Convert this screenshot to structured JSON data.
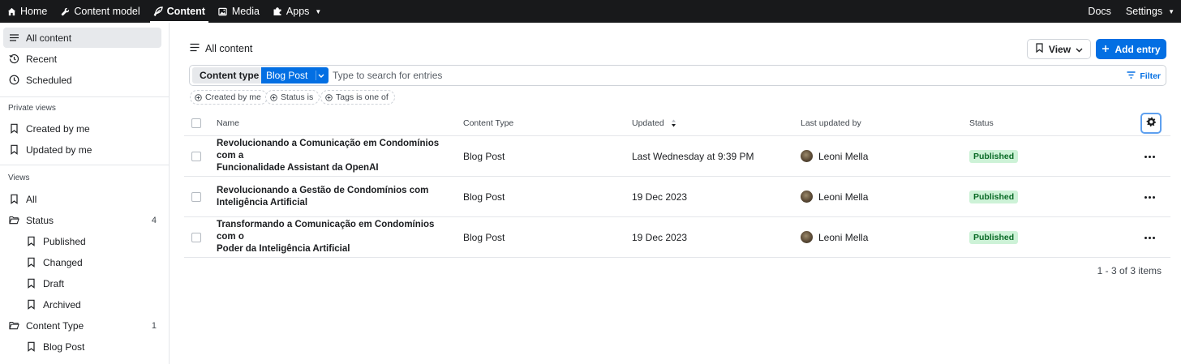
{
  "topnav": {
    "items": [
      {
        "label": "Home",
        "icon": "home-icon"
      },
      {
        "label": "Content model",
        "icon": "wrench-icon"
      },
      {
        "label": "Content",
        "icon": "feather-icon",
        "active": true
      },
      {
        "label": "Media",
        "icon": "image-icon"
      },
      {
        "label": "Apps",
        "icon": "puzzle-icon"
      }
    ],
    "docs": "Docs",
    "settings": "Settings"
  },
  "sidebar": {
    "top_items": [
      {
        "label": "All content",
        "icon": "list-icon",
        "active": true
      },
      {
        "label": "Recent",
        "icon": "history-icon"
      },
      {
        "label": "Scheduled",
        "icon": "clock-icon"
      }
    ],
    "private_heading": "Private views",
    "private_items": [
      {
        "label": "Created by me",
        "icon": "bookmark-icon"
      },
      {
        "label": "Updated by me",
        "icon": "bookmark-icon"
      }
    ],
    "views_heading": "Views",
    "views": {
      "all": "All",
      "status_folder": "Status",
      "status_count": "4",
      "status_items": [
        "Published",
        "Changed",
        "Draft",
        "Archived"
      ],
      "content_type_folder": "Content Type",
      "content_type_count": "1",
      "content_type_items": [
        "Blog Post"
      ]
    }
  },
  "main": {
    "title": "All content",
    "view_button": "View",
    "add_button": "Add entry",
    "search": {
      "content_type_label": "Content type",
      "content_type_value": "Blog Post",
      "placeholder": "Type to search for entries",
      "filter_label": "Filter"
    },
    "chips": [
      "Created by me",
      "Status is",
      "Tags is one of"
    ],
    "table": {
      "columns": [
        "Name",
        "Content Type",
        "Updated",
        "Last updated by",
        "Status"
      ],
      "rows": [
        {
          "name_line1": "Revolucionando a Comunicação em Condomínios com a",
          "name_line2": "Funcionalidade Assistant da OpenAI",
          "content_type": "Blog Post",
          "updated": "Last Wednesday at 9:39 PM",
          "author": "Leoni Mella",
          "status": "Published"
        },
        {
          "name_line1": "Revolucionando a Gestão de Condomínios com",
          "name_line2": "Inteligência Artificial",
          "content_type": "Blog Post",
          "updated": "19 Dec 2023",
          "author": "Leoni Mella",
          "status": "Published"
        },
        {
          "name_line1": "Transformando a Comunicação em Condomínios com o",
          "name_line2": "Poder da Inteligência Artificial",
          "content_type": "Blog Post",
          "updated": "19 Dec 2023",
          "author": "Leoni Mella",
          "status": "Published"
        }
      ]
    },
    "pagination": "1 - 3 of 3 items"
  },
  "colors": {
    "nav_bg": "#18191b",
    "primary": "#036fe3",
    "published_bg": "#cdf2d7",
    "published_text": "#0a6a26"
  }
}
